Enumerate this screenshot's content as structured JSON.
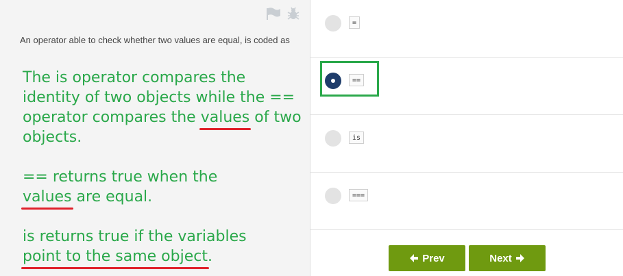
{
  "question": {
    "text": "An operator able to check whether two values are equal, is coded as"
  },
  "header_icons": [
    "flag-icon",
    "bug-icon"
  ],
  "notes": {
    "p1_pre": "The is operator compares the identity of two objects while the == operator compares the ",
    "p1_ul": "values",
    "p1_post": " of two objects.",
    "p2_pre": "== returns true when the ",
    "p2_ul": "values",
    "p2_post": " are equal.",
    "p3_pre": "is returns true if the variables ",
    "p3_ul": "point to the same object",
    "p3_post": "."
  },
  "options": [
    {
      "code": "=",
      "selected": false
    },
    {
      "code": "==",
      "selected": true
    },
    {
      "code": "is",
      "selected": false
    },
    {
      "code": "===",
      "selected": false
    }
  ],
  "nav": {
    "prev_label": "Prev",
    "next_label": "Next"
  },
  "colors": {
    "button": "#6f9a10",
    "annotation_green": "#2aa84a",
    "underline_red": "#e0202a",
    "radio_selected": "#1f3d6b"
  }
}
